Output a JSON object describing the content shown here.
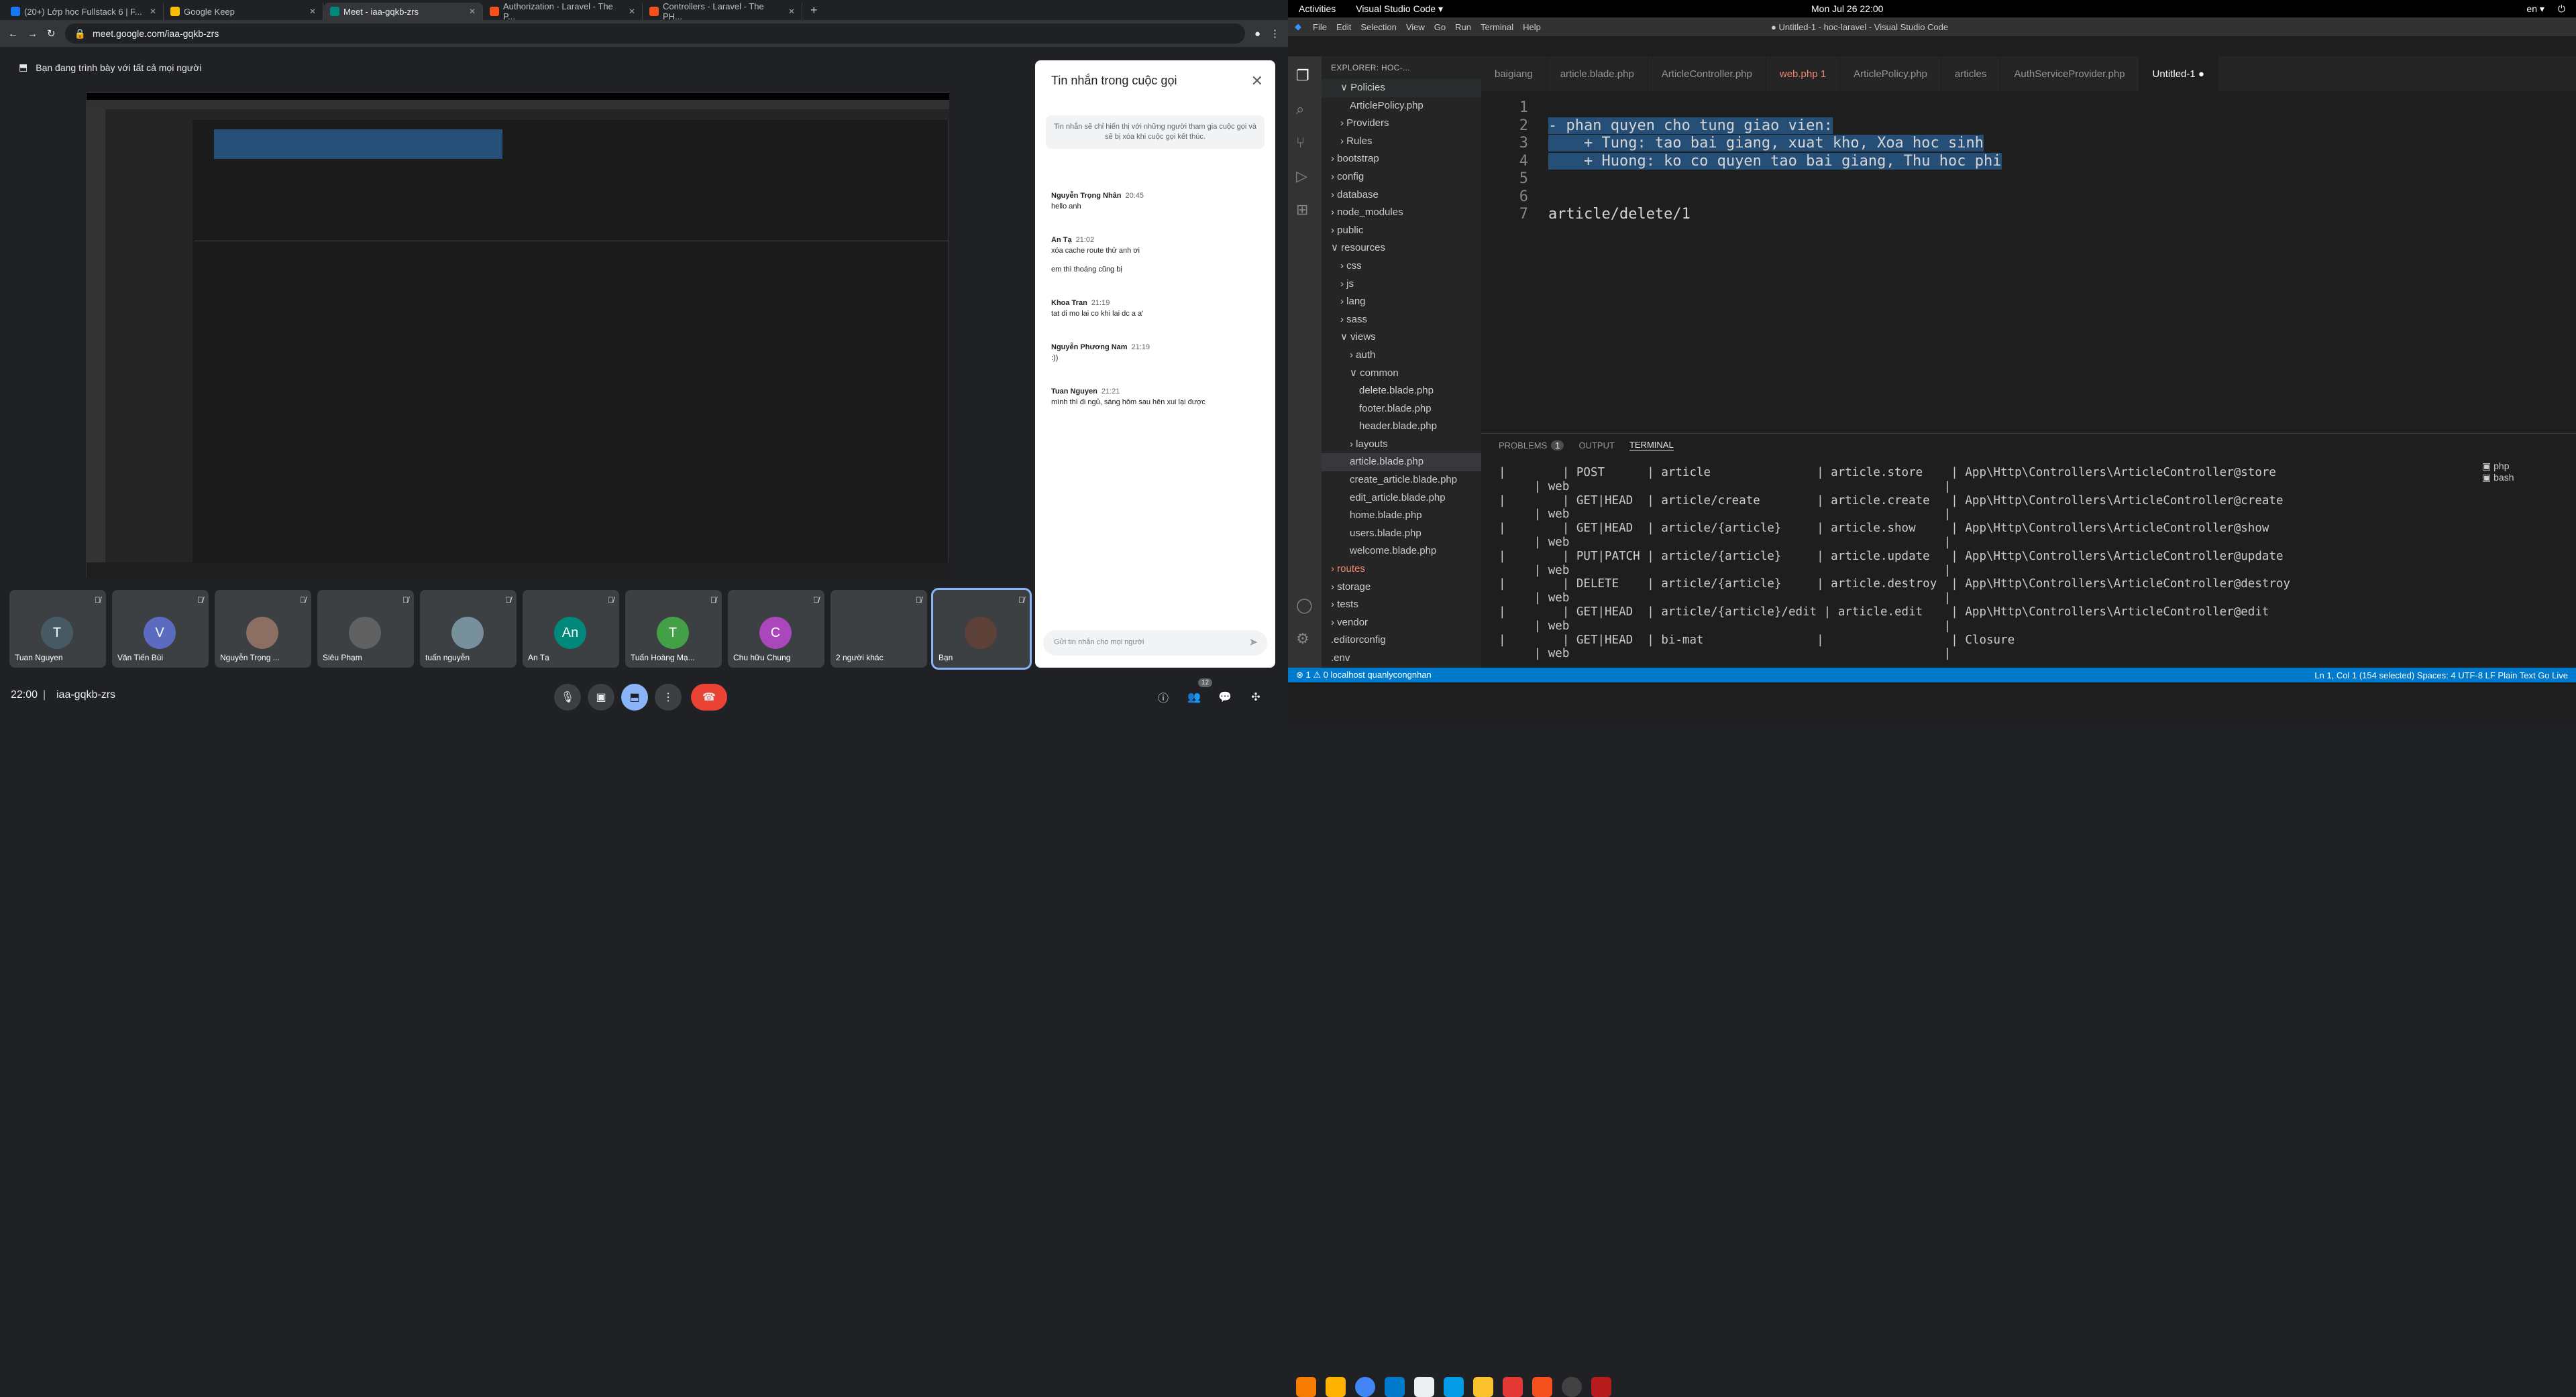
{
  "chrome": {
    "tabs": [
      {
        "title": "(20+) Lớp học Fullstack 6 | F...",
        "color": "#1877f2"
      },
      {
        "title": "Google Keep",
        "color": "#fbbc04"
      },
      {
        "title": "Meet - iaa-gqkb-zrs",
        "color": "#00897b",
        "active": true
      },
      {
        "title": "Authorization - Laravel - The P...",
        "color": "#f4511e"
      },
      {
        "title": "Controllers - Laravel - The PH...",
        "color": "#f4511e"
      }
    ],
    "url": "meet.google.com/iaa-gqkb-zrs",
    "new_tab": "+",
    "back": "←",
    "forward": "→",
    "reload": "↻"
  },
  "meet": {
    "presenting_notice": "Bạn đang trình bày với tất cả mọi người",
    "chat": {
      "title": "Tin nhắn trong cuộc gọi",
      "note": "Tin nhắn sẽ chỉ hiển thị với những người tham gia cuộc gọi và sẽ bị xóa khi cuộc gọi kết thúc.",
      "messages": [
        {
          "who": "Nguyễn Trọng Nhân",
          "time": "20:45",
          "lines": [
            "hello anh"
          ]
        },
        {
          "who": "An Tạ",
          "time": "21:02",
          "lines": [
            "xóa cache route thử anh ơi",
            "em thì thoáng cũng bị"
          ]
        },
        {
          "who": "Khoa Tran",
          "time": "21:19",
          "lines": [
            "tat di mo lai co khi lai dc a a'"
          ]
        },
        {
          "who": "Nguyễn Phương Nam",
          "time": "21:19",
          "lines": [
            ":))"
          ]
        },
        {
          "who": "Tuan Nguyen",
          "time": "21:21",
          "lines": [
            "mình thì đi ngủ, sáng hôm sau hên xui lại được"
          ]
        }
      ],
      "input_placeholder": "Gửi tin nhắn cho mọi người"
    },
    "participants": [
      {
        "name": "Tuan Nguyen",
        "initial": "T",
        "color": "#455a64"
      },
      {
        "name": "Văn Tiến Bùi",
        "initial": "V",
        "color": "#5c6bc0"
      },
      {
        "name": "Nguyễn Trọng ...",
        "initial": "",
        "color": "#8d6e63"
      },
      {
        "name": "Siêu Phạm",
        "initial": "",
        "color": "#616161"
      },
      {
        "name": "tuấn nguyễn",
        "initial": "",
        "color": "#78909c"
      },
      {
        "name": "An Tạ",
        "initial": "An",
        "color": "#00897b"
      },
      {
        "name": "Tuấn Hoàng Mạ...",
        "initial": "T",
        "color": "#43a047"
      },
      {
        "name": "Chu hữu Chung",
        "initial": "C",
        "color": "#ab47bc"
      },
      {
        "name": "2 người khác",
        "initial": "",
        "color": "#3c4043"
      },
      {
        "name": "Bạn",
        "initial": "",
        "color": "#5d4037"
      }
    ],
    "time": "22:00",
    "meeting_code": "iaa-gqkb-zrs",
    "people_count": "12"
  },
  "desktop": {
    "activities": "Activities",
    "app": "Visual Studio Code ▾",
    "clock": "Mon Jul 26  22:00",
    "lang": "en ▾"
  },
  "vscode": {
    "title": "● Untitled-1 - hoc-laravel - Visual Studio Code",
    "menu": [
      "File",
      "Edit",
      "Selection",
      "View",
      "Go",
      "Run",
      "Terminal",
      "Help"
    ],
    "explorer_title": "EXPLORER: HOC-...",
    "tree": [
      {
        "t": "∨ Policies",
        "d": 1,
        "hl": true
      },
      {
        "t": "ArticlePolicy.php",
        "d": 2,
        "c": "#a074c4"
      },
      {
        "t": "› Providers",
        "d": 1
      },
      {
        "t": "› Rules",
        "d": 1
      },
      {
        "t": "› bootstrap",
        "d": 0
      },
      {
        "t": "› config",
        "d": 0
      },
      {
        "t": "› database",
        "d": 0
      },
      {
        "t": "› node_modules",
        "d": 0
      },
      {
        "t": "› public",
        "d": 0
      },
      {
        "t": "∨ resources",
        "d": 0
      },
      {
        "t": "› css",
        "d": 1
      },
      {
        "t": "› js",
        "d": 1
      },
      {
        "t": "› lang",
        "d": 1
      },
      {
        "t": "› sass",
        "d": 1
      },
      {
        "t": "∨ views",
        "d": 1
      },
      {
        "t": "› auth",
        "d": 2
      },
      {
        "t": "∨ common",
        "d": 2
      },
      {
        "t": "delete.blade.php",
        "d": 3,
        "c": "#f05340"
      },
      {
        "t": "footer.blade.php",
        "d": 3,
        "c": "#f05340"
      },
      {
        "t": "header.blade.php",
        "d": 3,
        "c": "#f05340"
      },
      {
        "t": "› layouts",
        "d": 2
      },
      {
        "t": "article.blade.php",
        "d": 2,
        "c": "#f05340",
        "sel": true
      },
      {
        "t": "create_article.blade.php",
        "d": 2,
        "c": "#f05340"
      },
      {
        "t": "edit_article.blade.php",
        "d": 2,
        "c": "#f05340"
      },
      {
        "t": "home.blade.php",
        "d": 2,
        "c": "#f05340"
      },
      {
        "t": "users.blade.php",
        "d": 2,
        "c": "#f05340"
      },
      {
        "t": "welcome.blade.php",
        "d": 2,
        "c": "#f05340"
      },
      {
        "t": "› routes",
        "d": 0,
        "red": true
      },
      {
        "t": "› storage",
        "d": 0
      },
      {
        "t": "› tests",
        "d": 0
      },
      {
        "t": "› vendor",
        "d": 0
      },
      {
        "t": ".editorconfig",
        "d": 0
      },
      {
        "t": ".env",
        "d": 0
      }
    ],
    "tabs": [
      {
        "label": "baigiang"
      },
      {
        "label": "article.blade.php"
      },
      {
        "label": "ArticleController.php"
      },
      {
        "label": "web.php 1",
        "mod": true
      },
      {
        "label": "ArticlePolicy.php"
      },
      {
        "label": "articles"
      },
      {
        "label": "AuthServiceProvider.php"
      },
      {
        "label": "Untitled-1 ●",
        "active": true
      }
    ],
    "lines": [
      "",
      "- phan quyen cho tung giao vien:",
      "    + Tung: tao bai giang, xuat kho, Xoa hoc sinh",
      "    + Huong: ko co quyen tao bai giang, Thu hoc phi",
      "",
      "",
      "article/delete/1"
    ],
    "panel_tabs": [
      "PROBLEMS",
      "OUTPUT",
      "TERMINAL"
    ],
    "problems_count": "1",
    "terminal": [
      "|        | POST      | article               | article.store    | App\\Http\\Controllers\\ArticleController@store",
      "     | web                                                     |",
      "|        | GET|HEAD  | article/create        | article.create   | App\\Http\\Controllers\\ArticleController@create",
      "     | web                                                     |",
      "|        | GET|HEAD  | article/{article}     | article.show     | App\\Http\\Controllers\\ArticleController@show",
      "     | web                                                     |",
      "|        | PUT|PATCH | article/{article}     | article.update   | App\\Http\\Controllers\\ArticleController@update",
      "     | web                                                     |",
      "|        | DELETE    | article/{article}     | article.destroy  | App\\Http\\Controllers\\ArticleController@destroy",
      "     | web                                                     |",
      "|        | GET|HEAD  | article/{article}/edit | article.edit    | App\\Http\\Controllers\\ArticleController@edit",
      "     | web                                                     |",
      "|        | GET|HEAD  | bi-mat                |                  | Closure",
      "     | web                                                     |"
    ],
    "shells": [
      "php",
      "bash"
    ],
    "status_left": "⊗ 1 ⚠ 0     localhost  quanlycongnhan",
    "status_right": "Ln 1, Col 1 (154 selected)   Spaces: 4   UTF-8   LF   Plain Text   Go Live"
  }
}
